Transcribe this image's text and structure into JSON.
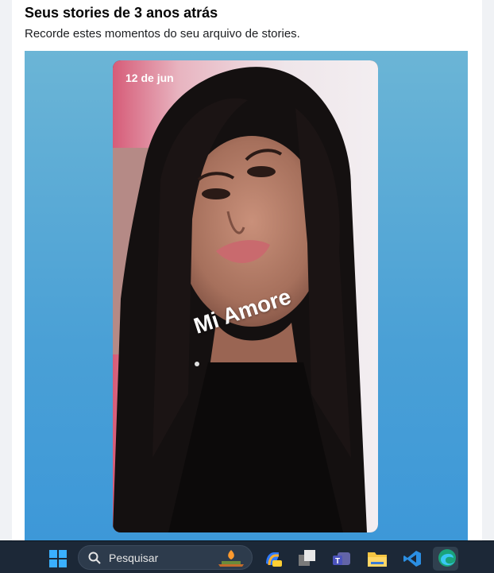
{
  "header": {
    "title": "Seus stories de 3 anos atrás",
    "subtitle": "Recorde estes momentos do seu arquivo de stories."
  },
  "story": {
    "date": "12 de jun",
    "caption": "Mi Amore"
  },
  "taskbar": {
    "search_placeholder": "Pesquisar",
    "apps": [
      "windows-start",
      "search",
      "game-widget",
      "copilot",
      "task-view",
      "teams",
      "file-explorer",
      "vscode",
      "edge"
    ]
  },
  "colors": {
    "story_background": "#4aa0d6",
    "taskbar": "#1c2837"
  }
}
